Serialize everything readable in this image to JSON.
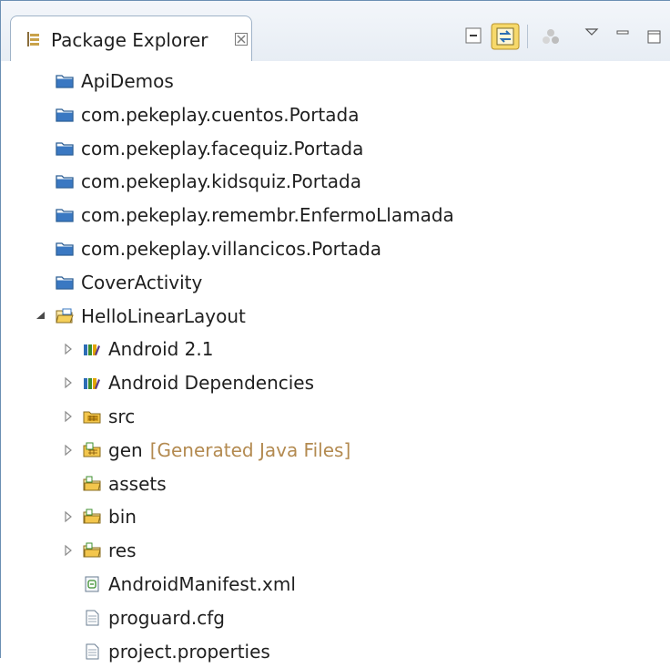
{
  "view": {
    "title": "Package Explorer",
    "close_glyph": "⊠"
  },
  "toolbar": {
    "icons": [
      "collapse-all-icon",
      "link-with-editor-icon",
      "focus-on-active-task-icon",
      "view-menu-icon",
      "minimize-icon",
      "maximize-icon"
    ]
  },
  "tree": [
    {
      "label": "ApiDemos",
      "icon": "closed-project-icon",
      "depth": 0,
      "twisty": "none"
    },
    {
      "label": "com.pekeplay.cuentos.Portada",
      "icon": "closed-project-icon",
      "depth": 0,
      "twisty": "none"
    },
    {
      "label": "com.pekeplay.facequiz.Portada",
      "icon": "closed-project-icon",
      "depth": 0,
      "twisty": "none"
    },
    {
      "label": "com.pekeplay.kidsquiz.Portada",
      "icon": "closed-project-icon",
      "depth": 0,
      "twisty": "none"
    },
    {
      "label": "com.pekeplay.remembr.EnfermoLlamada",
      "icon": "closed-project-icon",
      "depth": 0,
      "twisty": "none"
    },
    {
      "label": "com.pekeplay.villancicos.Portada",
      "icon": "closed-project-icon",
      "depth": 0,
      "twisty": "none"
    },
    {
      "label": "CoverActivity",
      "icon": "closed-project-icon",
      "depth": 0,
      "twisty": "none"
    },
    {
      "label": "HelloLinearLayout",
      "icon": "open-project-icon",
      "depth": 0,
      "twisty": "expanded"
    },
    {
      "label": "Android 2.1",
      "icon": "library-icon",
      "depth": 1,
      "twisty": "collapsed"
    },
    {
      "label": "Android Dependencies",
      "icon": "library-icon",
      "depth": 1,
      "twisty": "collapsed"
    },
    {
      "label": "src",
      "icon": "source-folder-icon",
      "depth": 1,
      "twisty": "collapsed"
    },
    {
      "label": "gen",
      "decoration": "[Generated Java Files]",
      "icon": "generated-source-folder-icon",
      "depth": 1,
      "twisty": "collapsed"
    },
    {
      "label": "assets",
      "icon": "folder-icon",
      "depth": 1,
      "twisty": "none"
    },
    {
      "label": "bin",
      "icon": "folder-icon",
      "depth": 1,
      "twisty": "collapsed"
    },
    {
      "label": "res",
      "icon": "folder-icon",
      "depth": 1,
      "twisty": "collapsed"
    },
    {
      "label": "AndroidManifest.xml",
      "icon": "xml-file-icon",
      "depth": 1,
      "twisty": "none"
    },
    {
      "label": "proguard.cfg",
      "icon": "text-file-icon",
      "depth": 1,
      "twisty": "none"
    },
    {
      "label": "project.properties",
      "icon": "text-file-icon",
      "depth": 1,
      "twisty": "none"
    }
  ],
  "colors": {
    "border": "#6b8fb3",
    "decoration": "#b38a50",
    "text": "#1f1f1f",
    "project_blue": "#3a78c2",
    "library_green": "#3c8f2e"
  }
}
